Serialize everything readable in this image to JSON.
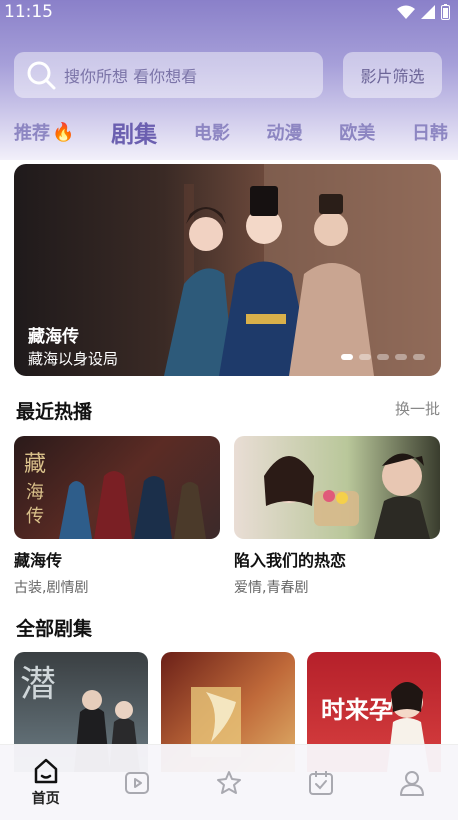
{
  "status_bar": {
    "time": "11:15"
  },
  "search": {
    "placeholder": "搜你所想 看你想看",
    "filter_label": "影片筛选"
  },
  "tabs": [
    {
      "label": "推荐"
    },
    {
      "label": "剧集"
    },
    {
      "label": "电影"
    },
    {
      "label": "动漫"
    },
    {
      "label": "欧美"
    },
    {
      "label": "日韩"
    }
  ],
  "banner": {
    "title": "藏海传",
    "subtitle": "藏海以身设局",
    "poster_text": "藏海传"
  },
  "recent": {
    "title": "最近热播",
    "refresh_label": "换一批",
    "items": [
      {
        "title": "藏海传",
        "tags": "古装,剧情剧"
      },
      {
        "title": "陷入我们的热恋",
        "tags": "爱情,青春剧"
      }
    ]
  },
  "all": {
    "title": "全部剧集",
    "poster_text_1": "潜",
    "poster_text_3": "时来孕"
  },
  "bottom_nav": [
    {
      "label": "首页",
      "icon": "home-icon"
    },
    {
      "label": "",
      "icon": "play-icon"
    },
    {
      "label": "",
      "icon": "star-icon"
    },
    {
      "label": "",
      "icon": "calendar-check-icon"
    },
    {
      "label": "",
      "icon": "user-icon"
    }
  ]
}
